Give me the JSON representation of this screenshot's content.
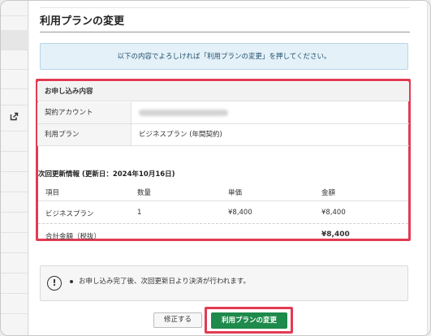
{
  "page": {
    "title": "利用プランの変更",
    "info_message": "以下の内容でよろしければ「利用プランの変更」を押してください。"
  },
  "application": {
    "section_title": "お申し込み内容",
    "rows": [
      {
        "key": "契約アカウント",
        "value": ""
      },
      {
        "key": "利用プラン",
        "value": "ビジネスプラン (年間契約)"
      }
    ]
  },
  "renewal": {
    "title": "次回更新情報 (更新日：2024年10月16日)",
    "headers": {
      "item": "項目",
      "qty": "数量",
      "unit_price": "単価",
      "amount": "金額"
    },
    "rows": [
      {
        "item": "ビジネスプラン",
        "qty": "1",
        "unit_price": "¥8,400",
        "amount": "¥8,400"
      }
    ],
    "total_label": "合計金額（税抜）",
    "total_value": "¥8,400"
  },
  "notice": {
    "text": "お申し込み完了後、次回更新日より決済が行われます。"
  },
  "buttons": {
    "fix_label": "修正する",
    "change_label": "利用プランの変更"
  },
  "colors": {
    "accent_green": "#1e8a4b",
    "highlight_red": "#e23b52",
    "info_bg": "#e4f1f8"
  }
}
